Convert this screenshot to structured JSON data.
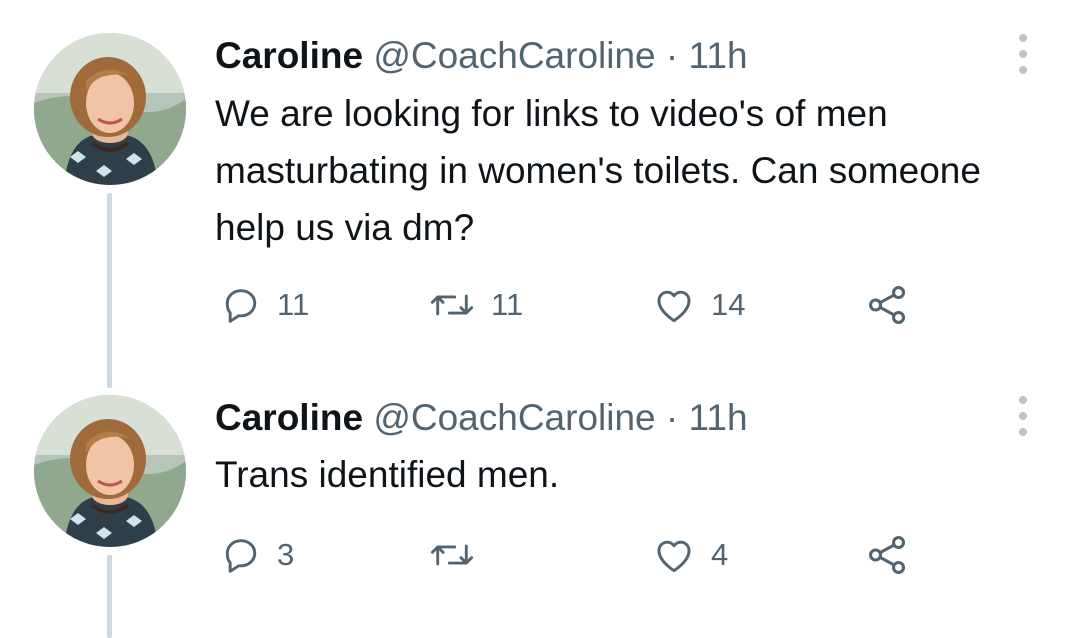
{
  "tweets": [
    {
      "name": "Caroline",
      "handle": "@CoachCaroline",
      "separator": "·",
      "time": "11h",
      "text": "We are looking for links to video's of men masturbating in women's toilets. Can someone help us via dm?",
      "reply_count": "11",
      "retweet_count": "11",
      "like_count": "14"
    },
    {
      "name": "Caroline",
      "handle": "@CoachCaroline",
      "separator": "·",
      "time": "11h",
      "text": "Trans identified men.",
      "reply_count": "3",
      "retweet_count": "",
      "like_count": "4"
    }
  ],
  "colors": {
    "primary_text": "#0f1419",
    "secondary_text": "#536471",
    "thread_line": "#cfd9de",
    "more_dots": "#b9c4cb"
  },
  "icons": [
    "more-vertical-icon",
    "reply-icon",
    "retweet-icon",
    "like-icon",
    "share-icon"
  ]
}
